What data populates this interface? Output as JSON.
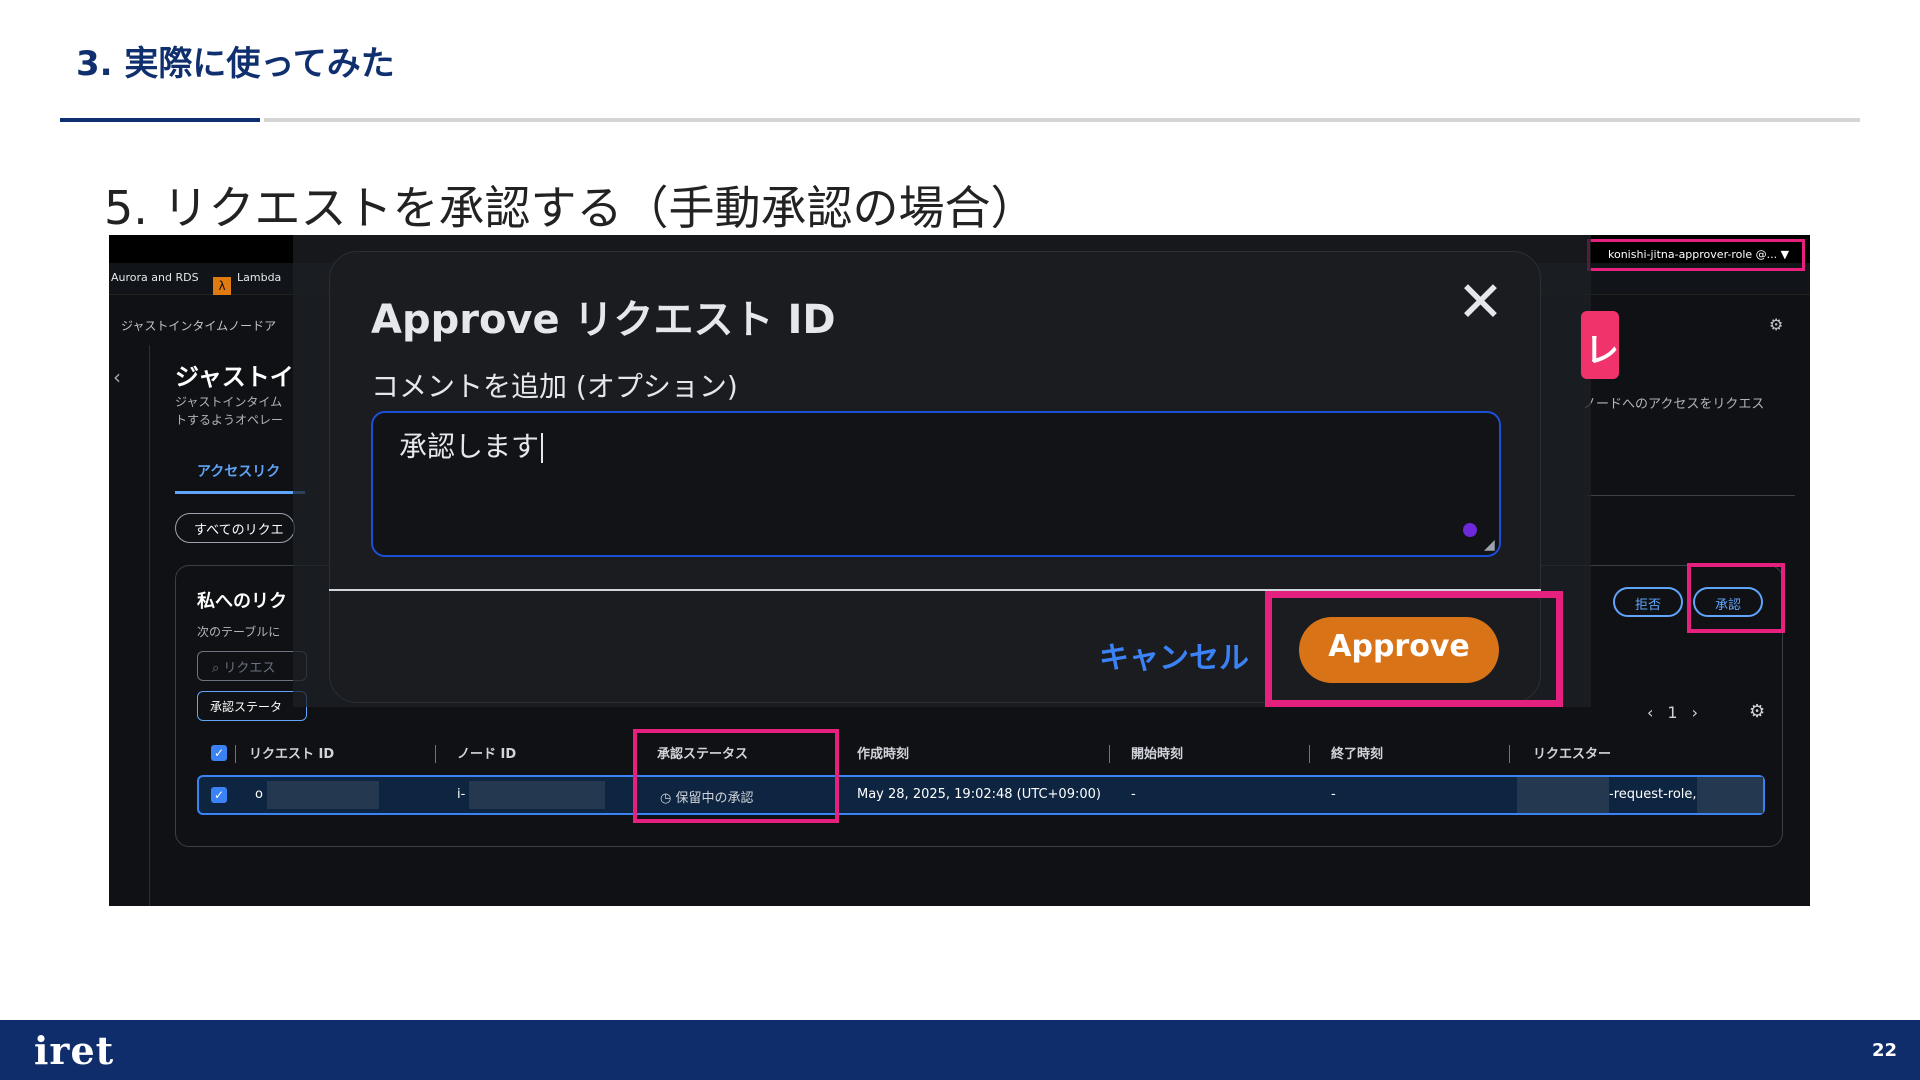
{
  "slide": {
    "section_title": "3. 実際に使ってみた",
    "step_title": "5. リクエストを承認する（手動承認の場合）",
    "page_number": "22",
    "logo_text": "iret"
  },
  "console": {
    "fav_aurora": "Aurora and RDS",
    "fav_lambda": "Lambda",
    "role_label": "konishi-jitna-approver-role @... ▼",
    "breadcrumb": "ジャストインタイムノードア",
    "page_heading": "ジャストイ",
    "page_desc_line1": "ジャストインタイム",
    "page_desc_line2": "トするようオペレー",
    "right_desc": "ノードへのアクセスをリクエス",
    "tab_access": "アクセスリク",
    "filter_all": "すべてのリクエ",
    "panel_heading": "私へのリク",
    "panel_desc": "次のテーブルに",
    "search_placeholder": "リクエス",
    "status_filter": "承認ステータ",
    "reject_button": "拒否",
    "approve_button": "承認",
    "pager_page": "1",
    "table": {
      "headers": [
        "リクエスト ID",
        "ノード ID",
        "承認ステータス",
        "作成時刻",
        "開始時刻",
        "終了時刻",
        "リクエスター"
      ],
      "row": {
        "request_id_prefix": "o",
        "node_id_prefix": "i-",
        "status": "保留中の承認",
        "created": "May 28, 2025, 19:02:48 (UTC+09:00)",
        "start": "-",
        "end": "-",
        "requester_suffix": "-request-role,"
      }
    }
  },
  "dialog": {
    "title": "Approve リクエスト ID",
    "comment_label": "コメントを追加 (オプション)",
    "comment_value": "承認します",
    "cancel_label": "キャンセル",
    "approve_label": "Approve"
  },
  "colors": {
    "highlight": "#e6207f",
    "approve_orange": "#d97318",
    "link_blue": "#3b82f6",
    "brand_navy": "#0f2d6b"
  }
}
